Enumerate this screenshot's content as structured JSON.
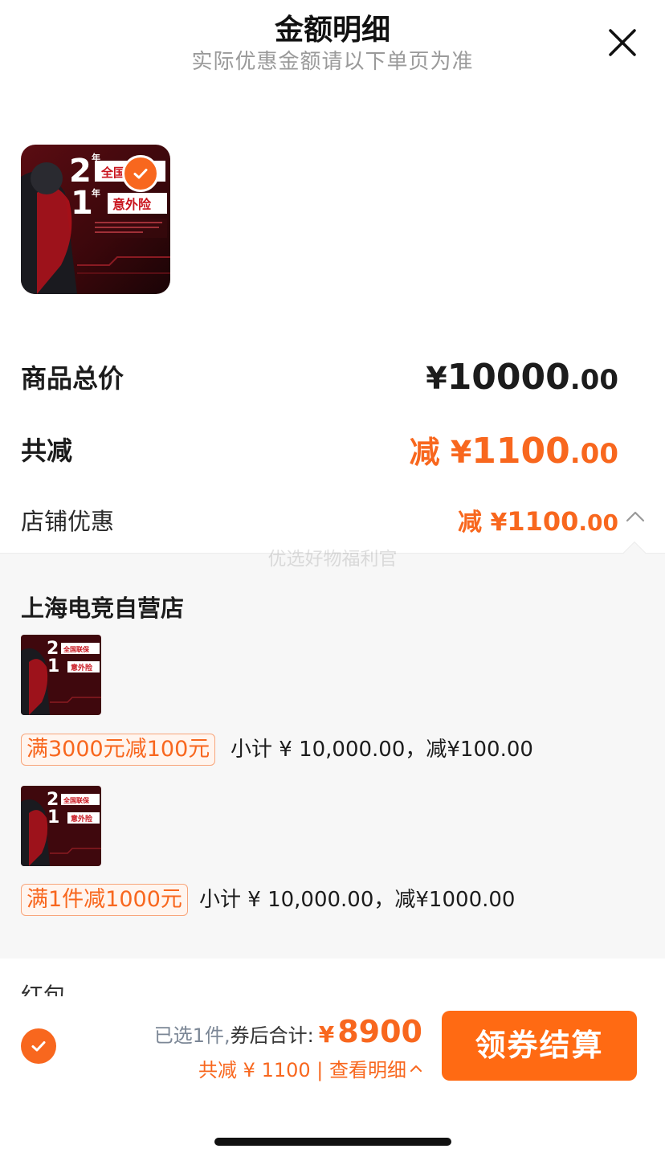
{
  "header": {
    "title": "金额明细",
    "subtitle": "实际优惠金额请以下单页为准",
    "close_icon": "close-icon"
  },
  "product": {
    "image_texts": [
      "2",
      "年",
      "全国",
      "1",
      "年",
      "意外险"
    ],
    "selected": true
  },
  "summary": {
    "total_label": "商品总价",
    "total_currency": "¥",
    "total_int": "10000",
    "total_dec": ".00",
    "reduce_label": "共减",
    "reduce_prefix": "减 ",
    "reduce_currency": "¥",
    "reduce_int": "1100",
    "reduce_dec": ".00",
    "store_label": "店铺优惠",
    "store_prefix": "减 ",
    "store_currency": "¥",
    "store_int": "1100",
    "store_dec": ".00"
  },
  "panel": {
    "watermark": "优选好物福利官",
    "shop_name": "上海电竞自营店",
    "items": [
      {
        "thumb_texts": [
          "2",
          "全国联保",
          "1",
          "意外险"
        ],
        "promo": "满3000元减100元",
        "subtotal": "小计 ¥ 10,000.00，减¥100.00"
      },
      {
        "thumb_texts": [
          "2",
          "全国联保",
          "1",
          "意外险"
        ],
        "promo": "满1件减1000元",
        "subtotal": "小计 ¥ 10,000.00，减¥1000.00"
      }
    ],
    "cut_row_label": "红包"
  },
  "bottom": {
    "selected_count": "已选1件,",
    "after_coupon_label": "券后合计:",
    "currency": "¥",
    "amount": "8900",
    "detail_text": "共减 ¥ 1100 | 查看明细",
    "checkout_label": "领券结算"
  },
  "colors": {
    "accent": "#f8671e",
    "button": "#ff6a13",
    "panel_bg": "#f7f7f7",
    "text": "#1c1c1c"
  }
}
